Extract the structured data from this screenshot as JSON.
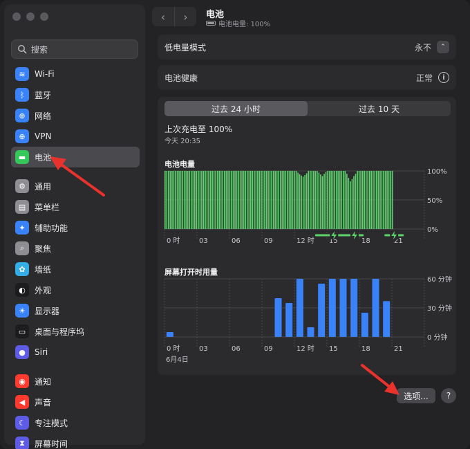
{
  "sidebar": {
    "search_label": "搜索",
    "items": [
      {
        "label": "Wi-Fi",
        "icon": "wifi-icon",
        "color": "#3a82f7"
      },
      {
        "label": "蓝牙",
        "icon": "bluetooth-icon",
        "color": "#3a82f7"
      },
      {
        "label": "网络",
        "icon": "globe-icon",
        "color": "#3a82f7"
      },
      {
        "label": "VPN",
        "icon": "vpn-globe-icon",
        "color": "#3a82f7"
      },
      {
        "label": "电池",
        "icon": "battery-icon",
        "color": "#34c759",
        "active": true
      },
      {
        "label": "通用",
        "icon": "gear-icon",
        "color": "#8e8e93"
      },
      {
        "label": "菜单栏",
        "icon": "menubar-icon",
        "color": "#8e8e93"
      },
      {
        "label": "辅助功能",
        "icon": "accessibility-icon",
        "color": "#3a82f7"
      },
      {
        "label": "聚焦",
        "icon": "spotlight-icon",
        "color": "#8e8e93"
      },
      {
        "label": "墙纸",
        "icon": "wallpaper-icon",
        "color": "#32ade6"
      },
      {
        "label": "外观",
        "icon": "appearance-icon",
        "color": "#1c1c1e"
      },
      {
        "label": "显示器",
        "icon": "display-icon",
        "color": "#3a82f7"
      },
      {
        "label": "桌面与程序坞",
        "icon": "dock-icon",
        "color": "#1c1c1e"
      },
      {
        "label": "Siri",
        "icon": "siri-icon",
        "color": "#5e5ce6"
      },
      {
        "label": "通知",
        "icon": "notification-icon",
        "color": "#ff3b30"
      },
      {
        "label": "声音",
        "icon": "sound-icon",
        "color": "#ff3b30"
      },
      {
        "label": "专注模式",
        "icon": "focus-moon-icon",
        "color": "#5e5ce6"
      },
      {
        "label": "屏幕时间",
        "icon": "hourglass-icon",
        "color": "#5e5ce6"
      }
    ]
  },
  "header": {
    "title": "电池",
    "subtitle": "电池电量: 100%"
  },
  "low_power": {
    "label": "低电量模式",
    "value": "永不"
  },
  "health": {
    "label": "电池健康",
    "value": "正常"
  },
  "tabs": [
    {
      "label": "过去 24 小时",
      "active": true
    },
    {
      "label": "过去 10 天",
      "active": false
    }
  ],
  "last_charge": {
    "title": "上次充电至 100%",
    "time": "今天 20:35"
  },
  "chart_data": [
    {
      "type": "bar",
      "title": "电池电量",
      "x_ticks": [
        "0 时",
        "03",
        "06",
        "09",
        "12 时",
        "15",
        "18",
        "21"
      ],
      "y_ticks": [
        "100%",
        "50%",
        "0%"
      ],
      "ylim": [
        0,
        100
      ],
      "values": [
        100,
        100,
        100,
        100,
        100,
        100,
        100,
        100,
        100,
        100,
        100,
        100,
        100,
        100,
        100,
        100,
        100,
        100,
        100,
        100,
        100,
        100,
        100,
        100,
        100,
        100,
        100,
        100,
        100,
        100,
        100,
        100,
        100,
        100,
        100,
        100,
        100,
        100,
        100,
        100,
        100,
        100,
        100,
        100,
        100,
        100,
        100,
        100,
        100,
        100,
        100,
        100,
        100,
        100,
        100,
        100,
        100,
        100,
        100,
        100,
        100,
        100,
        100,
        100,
        100,
        100,
        100,
        100,
        100,
        100,
        100,
        100,
        100,
        100,
        100,
        100,
        97,
        94,
        92,
        90,
        93,
        96,
        100,
        100,
        100,
        100,
        100,
        100,
        97,
        94,
        91,
        95,
        98,
        100,
        100,
        100,
        100,
        100,
        100,
        100,
        100,
        100,
        100,
        100,
        95,
        88,
        82,
        86,
        91,
        95,
        100,
        100,
        100,
        100,
        100,
        100,
        100,
        100,
        100,
        100,
        100,
        100,
        100,
        100,
        100,
        100,
        100,
        100,
        100,
        100,
        100
      ],
      "charging_periods": [
        [
          14,
          17.3
        ],
        [
          16.8,
          18.3
        ],
        [
          20.4,
          22
        ]
      ],
      "color": "#5dd36b"
    },
    {
      "type": "bar",
      "title": "屏幕打开时用量",
      "x_ticks": [
        "0 时",
        "03",
        "06",
        "09",
        "12 时",
        "15",
        "18",
        "21"
      ],
      "y_ticks": [
        "60 分钟",
        "30 分钟",
        "0 分钟"
      ],
      "ylim": [
        0,
        60
      ],
      "categories": [
        0,
        1,
        2,
        3,
        4,
        5,
        6,
        7,
        8,
        9,
        10,
        11,
        12,
        13,
        14,
        15,
        16,
        17,
        18,
        19,
        20
      ],
      "values": [
        5,
        0,
        0,
        0,
        0,
        0,
        0,
        0,
        0,
        0,
        40,
        35,
        60,
        10,
        55,
        60,
        60,
        60,
        25,
        60,
        37
      ],
      "date_label": "6月4日",
      "color": "#3a82f7"
    }
  ],
  "footer": {
    "options_label": "选项...",
    "help_label": "?"
  }
}
